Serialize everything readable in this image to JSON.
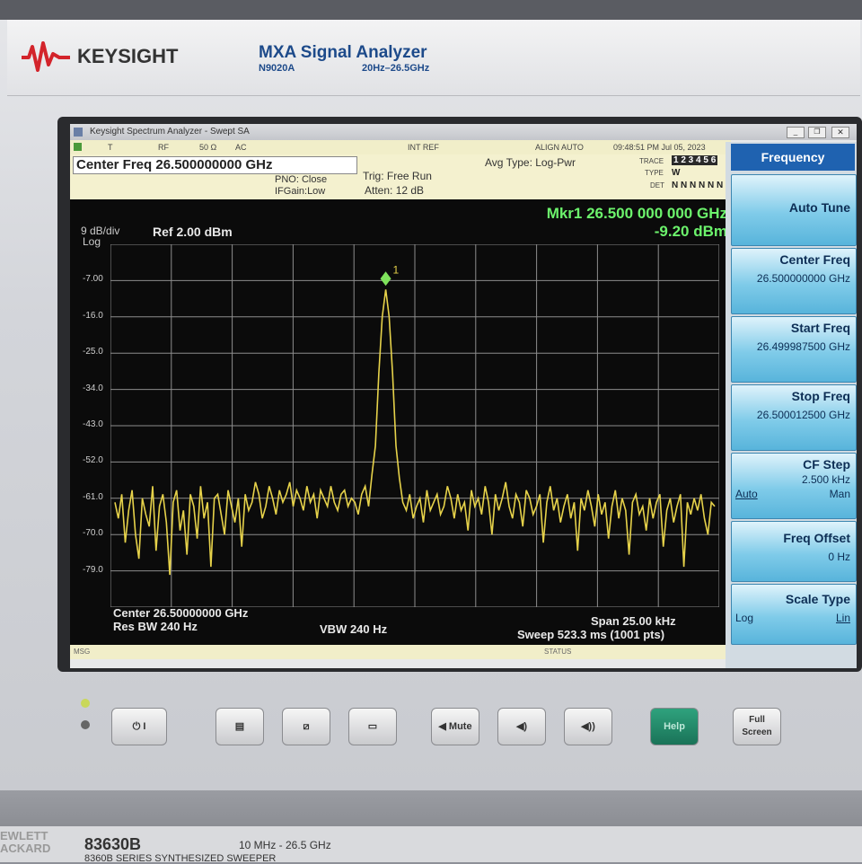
{
  "header": {
    "brand": "KEYSIGHT",
    "product": "MXA Signal Analyzer",
    "model": "N9020A",
    "range": "20Hz–26.5GHz"
  },
  "window": {
    "title": "Keysight Spectrum Analyzer - Swept SA"
  },
  "ribbon": {
    "t": "T",
    "rf": "RF",
    "ohm": "50 Ω",
    "ac": "AC",
    "intref": "INT REF",
    "align": "ALIGN AUTO",
    "datetime": "09:48:51 PM Jul 05, 2023"
  },
  "info": {
    "center": "Center Freq 26.500000000 GHz",
    "pno": "PNO: Close",
    "ifgain": "IFGain:Low",
    "trig": "Trig: Free Run",
    "atten": "Atten: 12 dB",
    "avg": "Avg Type: Log-Pwr",
    "trace_label": "TRACE",
    "type_label": "TYPE",
    "det_label": "DET",
    "trace_digits": "1 2 3 4 5 6",
    "type_value": "W",
    "det_value": "N N N N N N"
  },
  "marker": {
    "freq": "Mkr1 26.500 000 000 GHz",
    "level": "-9.20 dBm",
    "id": "1"
  },
  "scale": {
    "div": "9 dB/div",
    "log": "Log",
    "ref": "Ref 2.00 dBm"
  },
  "footer": {
    "center": "Center 26.50000000 GHz",
    "rbw": "Res BW 240 Hz",
    "vbw": "VBW 240 Hz",
    "span": "Span 25.00 kHz",
    "sweep": "Sweep  523.3 ms (1001 pts)",
    "msg": "MSG",
    "status": "STATUS"
  },
  "menu": {
    "title": "Frequency",
    "auto_tune": "Auto Tune",
    "center_label": "Center Freq",
    "center_val": "26.500000000 GHz",
    "start_label": "Start Freq",
    "start_val": "26.499987500 GHz",
    "stop_label": "Stop Freq",
    "stop_val": "26.500012500 GHz",
    "cfstep_label": "CF Step",
    "cfstep_val": "2.500 kHz",
    "cfstep_auto": "Auto",
    "cfstep_man": "Man",
    "offset_label": "Freq Offset",
    "offset_val": "0 Hz",
    "scale_label": "Scale Type",
    "scale_log": "Log",
    "scale_lin": "Lin"
  },
  "buttons": {
    "mute": "Mute",
    "help": "Help",
    "full": "Full Screen"
  },
  "lower": {
    "brand": "EWLETT ACKARD",
    "model": "83630B",
    "range": "10 MHz - 26.5 GHz",
    "series": "8360B SERIES SYNTHESIZED SWEEPER"
  },
  "chart_data": {
    "type": "line",
    "ylabel": "dBm",
    "ylim": [
      -88,
      2
    ],
    "y_ticks": [
      "-7.00",
      "-16.0",
      "-25.0",
      "-34.0",
      "-43.0",
      "-52.0",
      "-61.0",
      "-70.0",
      "-79.0"
    ],
    "x_center_ghz": 26.5,
    "span_khz": 25,
    "trace_color": "#e6d24a",
    "series": [
      {
        "values": [
          -62,
          -66,
          -60,
          -72,
          -64,
          -59,
          -70,
          -76,
          -61,
          -65,
          -68,
          -58,
          -74,
          -63,
          -60,
          -67,
          -80,
          -62,
          -59,
          -69,
          -64,
          -75,
          -60,
          -63,
          -71,
          -58,
          -66,
          -62,
          -78,
          -61,
          -60,
          -65,
          -70,
          -59,
          -63,
          -67,
          -61,
          -73,
          -60,
          -64,
          -62,
          -57,
          -60,
          -66,
          -63,
          -58,
          -61,
          -65,
          -59,
          -62,
          -60,
          -57,
          -63,
          -59,
          -61,
          -64,
          -58,
          -62,
          -60,
          -66,
          -59,
          -61,
          -63,
          -58,
          -62,
          -64,
          -60,
          -59,
          -63,
          -61,
          -62,
          -65,
          -60,
          -58,
          -63,
          -55,
          -48,
          -30,
          -16,
          -9.2,
          -16,
          -30,
          -48,
          -56,
          -62,
          -64,
          -60,
          -66,
          -63,
          -61,
          -67,
          -59,
          -64,
          -62,
          -60,
          -65,
          -63,
          -58,
          -61,
          -66,
          -60,
          -64,
          -62,
          -69,
          -59,
          -63,
          -61,
          -65,
          -58,
          -62,
          -70,
          -60,
          -64,
          -61,
          -57,
          -63,
          -66,
          -60,
          -62,
          -68,
          -59,
          -61,
          -65,
          -63,
          -60,
          -72,
          -62,
          -58,
          -64,
          -61,
          -67,
          -63,
          -60,
          -66,
          -62,
          -74,
          -61,
          -64,
          -59,
          -63,
          -68,
          -60,
          -65,
          -62,
          -71,
          -63,
          -59,
          -66,
          -61,
          -64,
          -75,
          -62,
          -60,
          -65,
          -63,
          -69,
          -61,
          -66,
          -62,
          -60,
          -73,
          -64,
          -61,
          -67,
          -63,
          -60,
          -78,
          -62,
          -65,
          -61,
          -64,
          -60,
          -66,
          -70,
          -62,
          -63
        ]
      }
    ]
  }
}
